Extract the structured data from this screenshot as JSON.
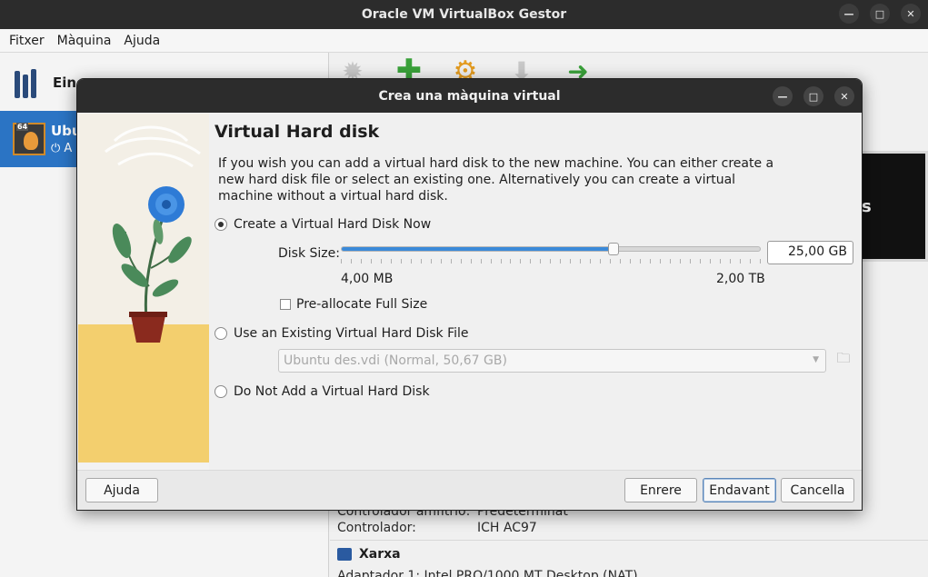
{
  "main_window": {
    "title": "Oracle VM VirtualBox Gestor",
    "controls": {
      "minimize": "—",
      "maximize": "□",
      "close": "✕"
    },
    "menu": [
      "Fitxer",
      "Màquina",
      "Ajuda"
    ],
    "sidebar": {
      "tools_label": "Eines",
      "vm_name": "Ubu",
      "vm_state": "A",
      "vm_badge": "64"
    },
    "preview_text": "s",
    "details": {
      "rows": [
        {
          "label": "Controlador amfitrió:",
          "value": "Predeterminat"
        },
        {
          "label": "Controlador:",
          "value": "ICH AC97"
        }
      ],
      "network_title": "Xarxa",
      "network_row": "Adaptador 1:   Intel PRO/1000 MT Desktop (NAT)"
    }
  },
  "dialog": {
    "title": "Crea una màquina virtual",
    "controls": {
      "minimize": "—",
      "maximize": "□",
      "close": "✕"
    },
    "heading": "Virtual Hard disk",
    "description": "If you wish you can add a virtual hard disk to the new machine. You can either create a new hard disk file or select an existing one. Alternatively you can create a virtual machine without a virtual hard disk.",
    "options": {
      "create_new": "Create a Virtual Hard Disk Now",
      "use_existing": "Use an Existing Virtual Hard Disk File",
      "do_not_add": "Do Not Add a Virtual Hard Disk",
      "selected": "create_new"
    },
    "disk_size": {
      "label": "Disk Size:",
      "value": "25,00 GB",
      "min_label": "4,00 MB",
      "max_label": "2,00 TB",
      "slider_fraction": 0.65
    },
    "preallocate": {
      "label": "Pre-allocate Full Size",
      "checked": false
    },
    "existing_file": {
      "value": "Ubuntu des.vdi (Normal, 50,67 GB)"
    },
    "buttons": {
      "help": "Ajuda",
      "back": "Enrere",
      "next": "Endavant",
      "cancel": "Cancella"
    }
  },
  "colors": {
    "accent": "#3b8ad9",
    "selection": "#2b74c4",
    "titlebar": "#2c2c2c",
    "art_floor": "#f3cf6e",
    "plant_leaf": "#4a8a5a",
    "flower": "#2e7bd6",
    "pot": "#8a2a1e"
  },
  "icons": {
    "tools": "tools-icon",
    "toolbar": [
      "settings-disabled-icon",
      "new-machine-icon",
      "settings-gear-icon",
      "discard-icon",
      "start-arrow-icon"
    ],
    "folder": "folder-icon",
    "network": "network-icon"
  }
}
